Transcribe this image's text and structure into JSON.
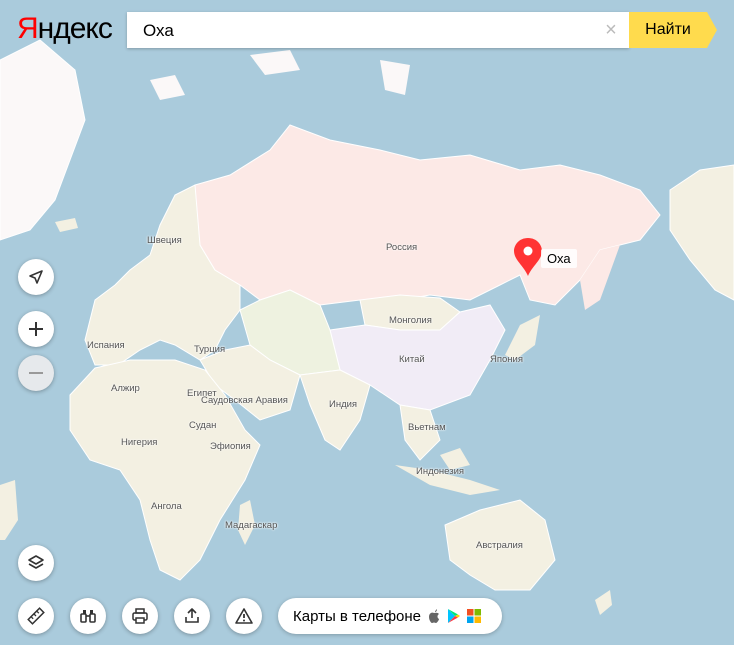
{
  "logo": {
    "first": "Я",
    "rest": "ндекс"
  },
  "search": {
    "query": "Оха",
    "clear_symbol": "×",
    "button_label": "Найти"
  },
  "marker": {
    "label": "Оха"
  },
  "map_labels": {
    "russia": "Россия",
    "sweden": "Швеция",
    "mongolia": "Монголия",
    "china": "Китай",
    "japan": "Япония",
    "spain": "Испания",
    "turkey": "Турция",
    "algeria": "Алжир",
    "egypt": "Египет",
    "saudi": "Саудовская Аравия",
    "india": "Индия",
    "vietnam": "Вьетнам",
    "sudan": "Судан",
    "nigeria": "Нигерия",
    "ethiopia": "Эфиопия",
    "indonesia": "Индонезия",
    "angola": "Ангола",
    "madagascar": "Мадагаскар",
    "australia": "Австралия"
  },
  "controls": {
    "locate": "location-arrow-icon",
    "zoom_in": "plus-icon",
    "zoom_out": "minus-icon",
    "layers": "layers-icon",
    "ruler": "ruler-icon",
    "panorama": "binoculars-icon",
    "print": "printer-icon",
    "share": "share-icon",
    "report": "warning-icon"
  },
  "phone_promo": {
    "label": "Карты в телефоне"
  },
  "colors": {
    "water": "#aacbdc",
    "land": "#f3f0e2",
    "russia": "#fce9e6",
    "china": "#f1ecf6",
    "accent": "#ffdb4d",
    "marker": "#f33"
  }
}
